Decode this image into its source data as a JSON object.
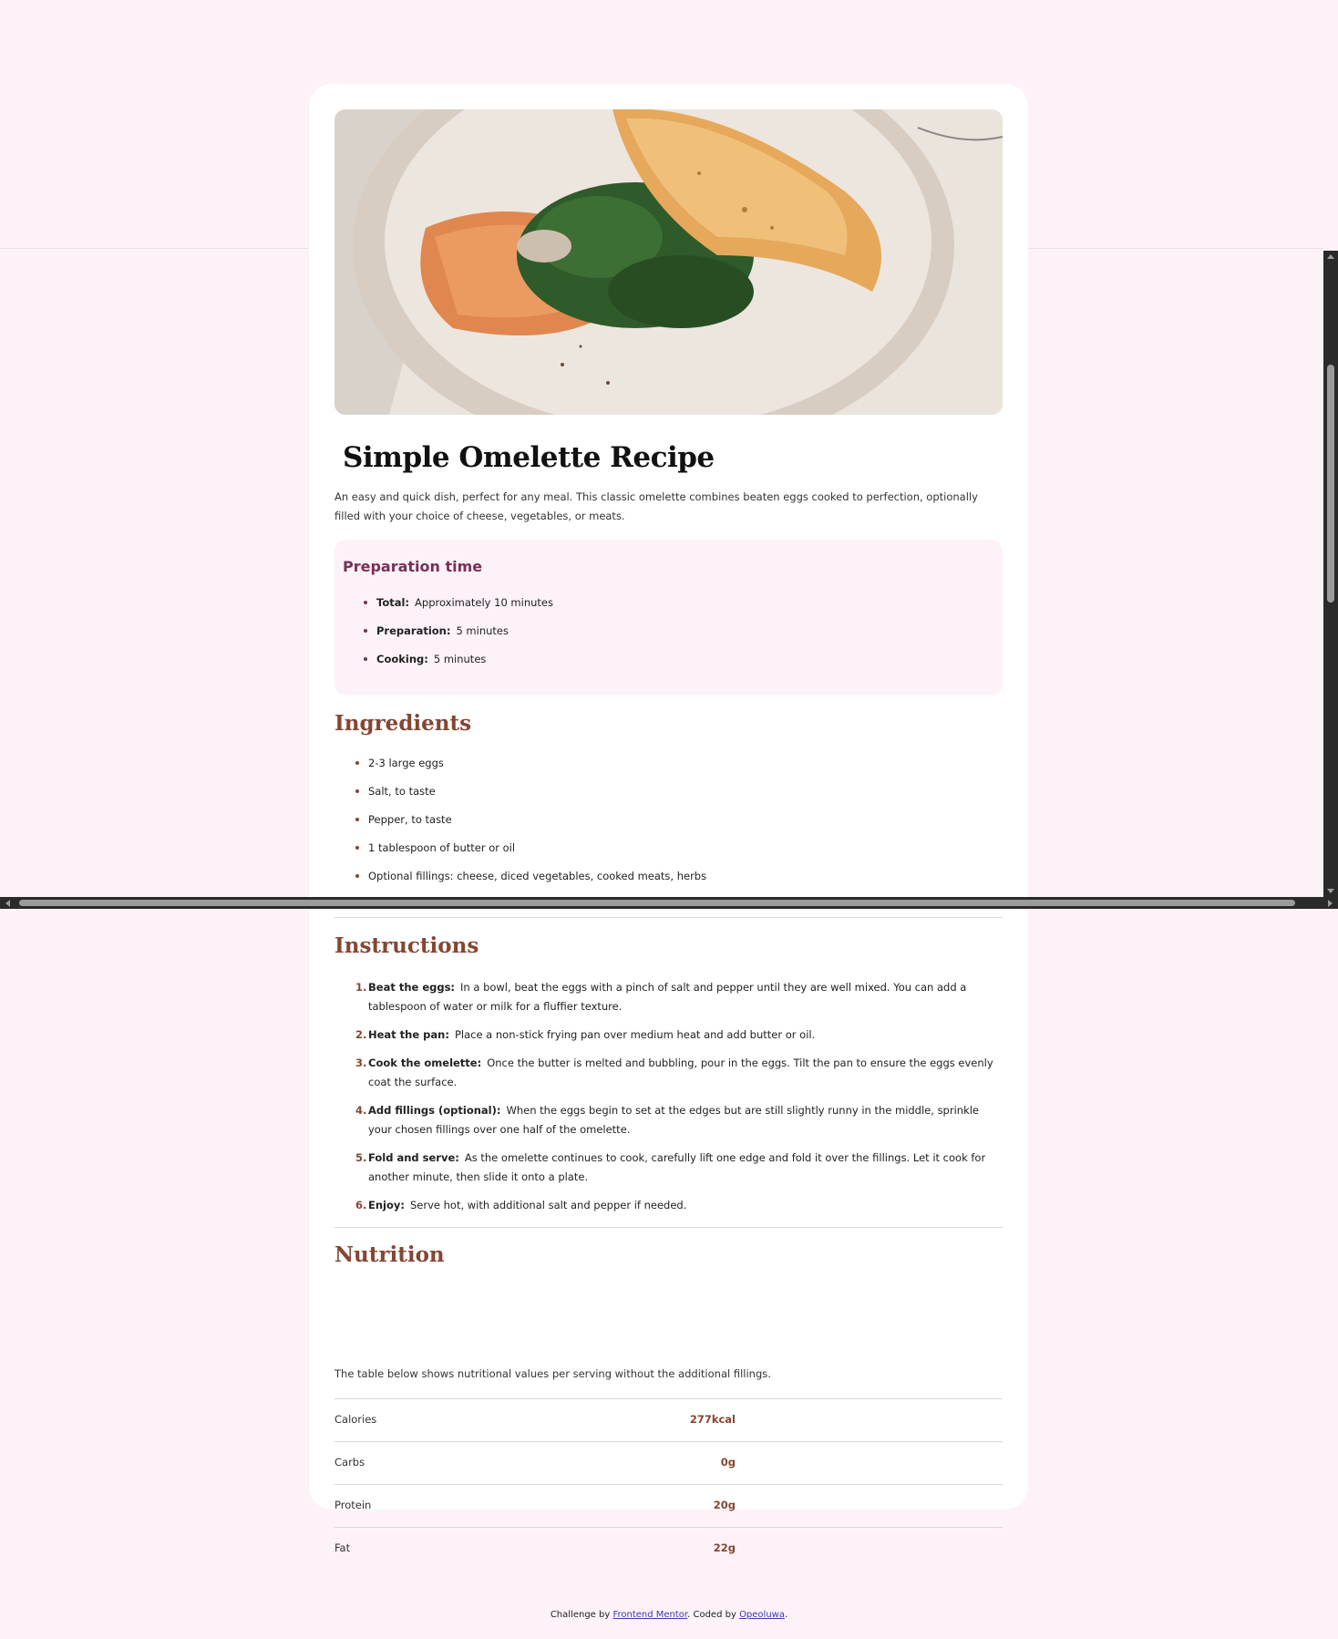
{
  "recipe": {
    "title": "Simple Omelette Recipe",
    "intro": "An easy and quick dish, perfect for any meal. This classic omelette combines beaten eggs cooked to perfection, optionally filled with your choice of cheese, vegetables, or meats."
  },
  "preparation": {
    "heading": "Preparation time",
    "items": [
      {
        "label": "Total:",
        "value": "Approximately 10 minutes"
      },
      {
        "label": "Preparation:",
        "value": "5 minutes"
      },
      {
        "label": "Cooking:",
        "value": "5 minutes"
      }
    ]
  },
  "ingredients": {
    "heading": "Ingredients",
    "items": [
      "2-3 large eggs",
      "Salt, to taste",
      "Pepper, to taste",
      "1 tablespoon of butter or oil",
      "Optional fillings: cheese, diced vegetables, cooked meats, herbs"
    ]
  },
  "instructions": {
    "heading": "Instructions",
    "steps": [
      {
        "num": "1.",
        "label": "Beat the eggs:",
        "text": "In a bowl, beat the eggs with a pinch of salt and pepper until they are well mixed. You can add a tablespoon of water or milk for a fluffier texture."
      },
      {
        "num": "2.",
        "label": "Heat the pan:",
        "text": "Place a non-stick frying pan over medium heat and add butter or oil."
      },
      {
        "num": "3.",
        "label": "Cook the omelette:",
        "text": "Once the butter is melted and bubbling, pour in the eggs. Tilt the pan to ensure the eggs evenly coat the surface."
      },
      {
        "num": "4.",
        "label": "Add fillings (optional):",
        "text": "When the eggs begin to set at the edges but are still slightly runny in the middle, sprinkle your chosen fillings over one half of the omelette."
      },
      {
        "num": "5.",
        "label": "Fold and serve:",
        "text": "As the omelette continues to cook, carefully lift one edge and fold it over the fillings. Let it cook for another minute, then slide it onto a plate."
      },
      {
        "num": "6.",
        "label": "Enjoy:",
        "text": "Serve hot, with additional salt and pepper if needed."
      }
    ]
  },
  "nutrition": {
    "heading": "Nutrition",
    "description": "The table below shows nutritional values per serving without the additional fillings.",
    "rows": [
      {
        "label": "Calories",
        "value": "277kcal"
      },
      {
        "label": "Carbs",
        "value": "0g"
      },
      {
        "label": "Protein",
        "value": "20g"
      },
      {
        "label": "Fat",
        "value": "22g"
      }
    ]
  },
  "footer": {
    "prefix": "Challenge by ",
    "link1": "Frontend Mentor",
    "middle": ". Coded by ",
    "link2": "Opeoluwa",
    "suffix": "."
  },
  "colors": {
    "page_bg": "#fdf2f8",
    "accent_brown": "#854632",
    "accent_plum": "#7a2f55"
  }
}
